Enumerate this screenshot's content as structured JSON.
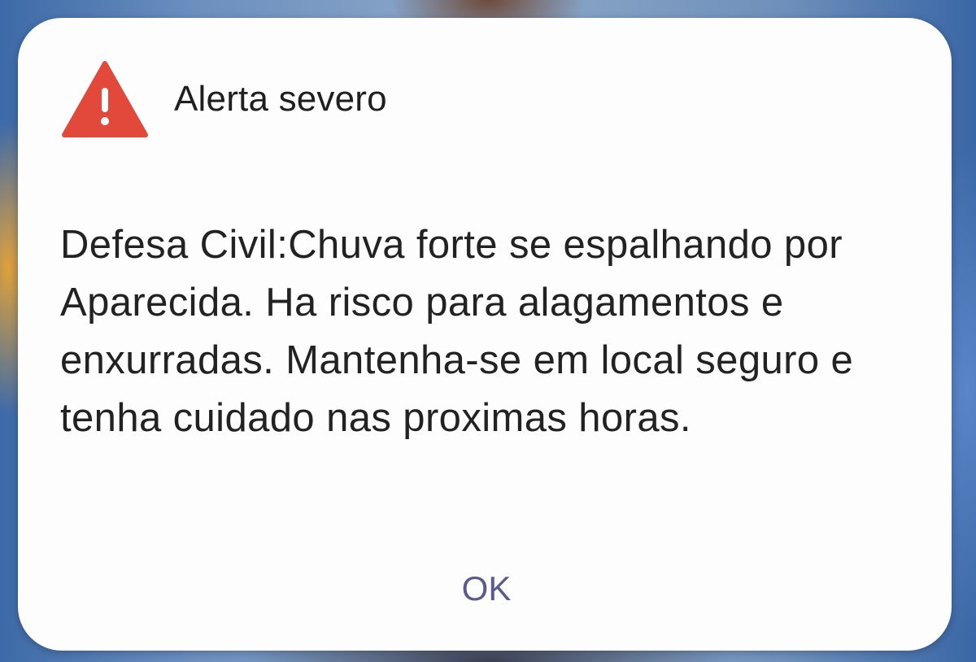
{
  "alert": {
    "icon": "warning-triangle-icon",
    "icon_color": "#e2493b",
    "title": "Alerta severo",
    "message": "Defesa Civil:Chuva forte se espalhando por Aparecida. Ha risco para alagamentos e enxurradas. Mantenha-se em local seguro e tenha cuidado nas proximas horas.",
    "ok_label": "OK",
    "ok_color": "#5a5a8e"
  }
}
